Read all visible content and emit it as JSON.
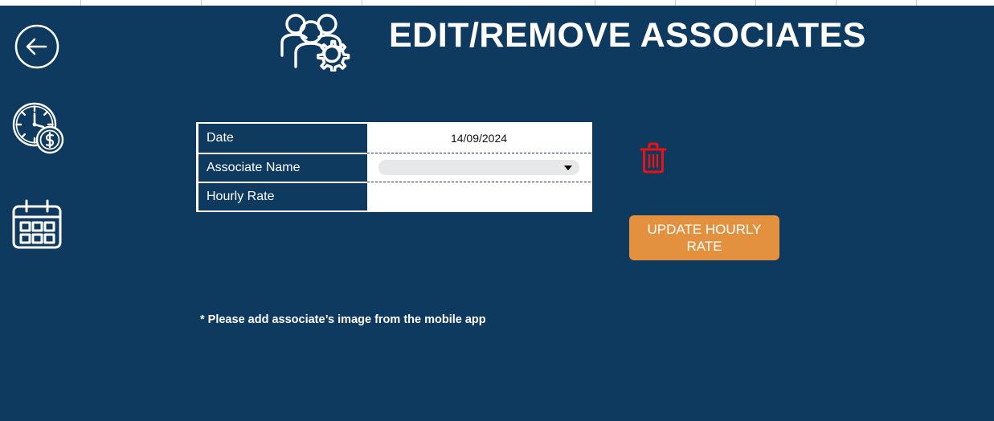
{
  "theme": {
    "background": "#0e3a60",
    "panel": "#ffffff",
    "accent_orange": "#e3913f",
    "danger_red": "#ee1111",
    "text_on_dark": "#ffffff",
    "dropdown_fill": "#e6e8ea"
  },
  "sheet_strip": {
    "column_line_positions": [
      100,
      250,
      450,
      740,
      840,
      940,
      1040,
      1140
    ]
  },
  "header": {
    "back_icon": "back-arrow-circle-icon",
    "brand_icon": "people-gear-icon",
    "title": "EDIT/REMOVE ASSOCIATES"
  },
  "left_rail": {
    "items": [
      {
        "icon": "clock-money-icon",
        "label": "Time and Pay"
      },
      {
        "icon": "calendar-icon",
        "label": "Calendar"
      }
    ]
  },
  "form": {
    "rows": [
      {
        "label": "Date",
        "type": "text",
        "value": "14/09/2024"
      },
      {
        "label": "Associate Name",
        "type": "dropdown",
        "value": "",
        "placeholder": ""
      },
      {
        "label": "Hourly Rate",
        "type": "text",
        "value": ""
      }
    ]
  },
  "actions": {
    "delete_icon": "trash-icon",
    "delete_label": "Delete",
    "update_button_label": "UPDATE HOURLY RATE"
  },
  "footnote": {
    "text": "* Please add associate’s image from the mobile app"
  }
}
